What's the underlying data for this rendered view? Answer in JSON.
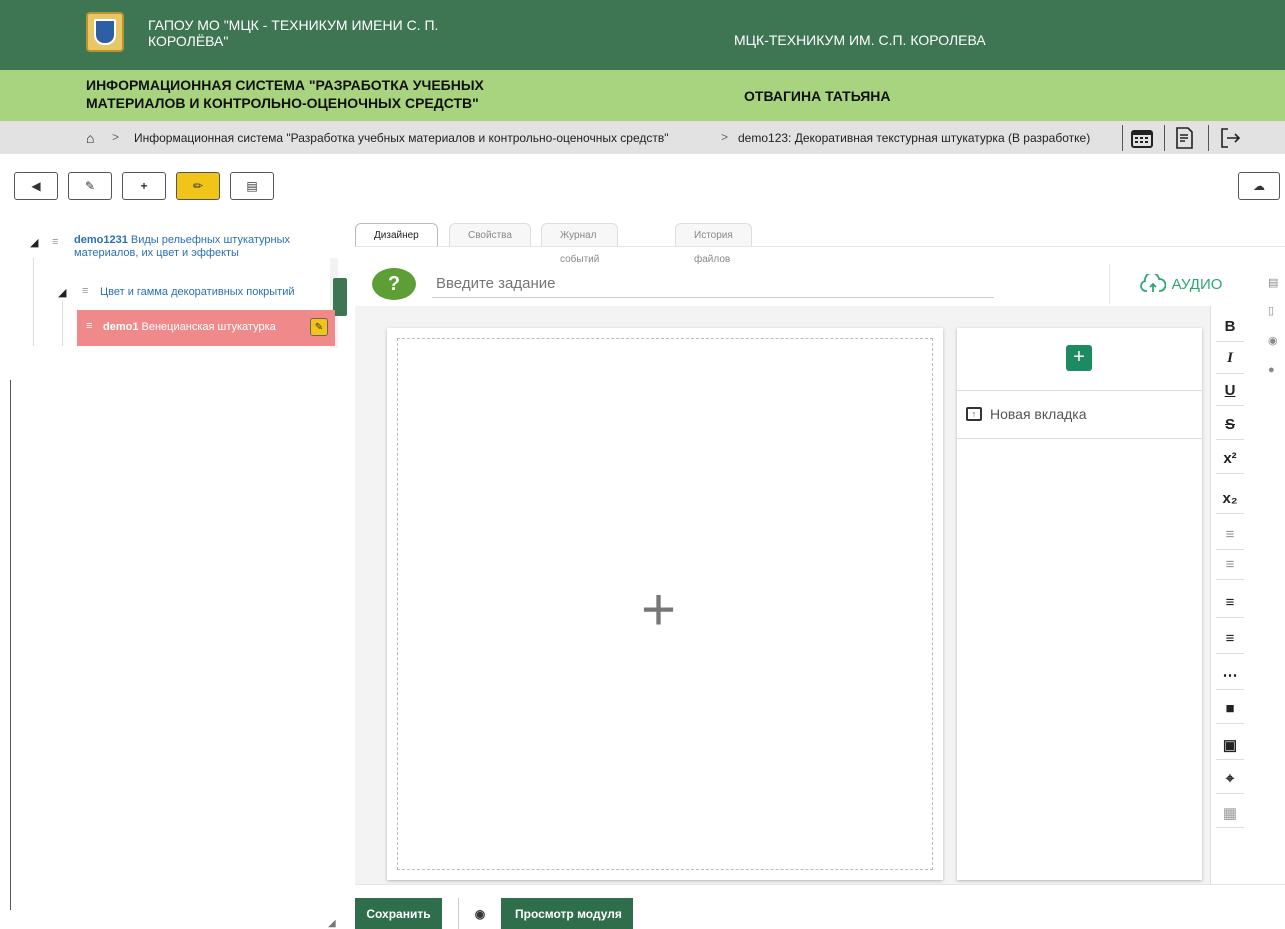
{
  "header": {
    "org_title": "ГАПОУ МО \"МЦК - ТЕХНИКУМ ИМЕНИ С. П. КОРОЛЁВА\"",
    "org_short": "МЦК-ТЕХНИКУМ ИМ. С.П. КОРОЛЕВА",
    "system_title": "ИНФОРМАЦИОННАЯ СИСТЕМА \"РАЗРАБОТКА УЧЕБНЫХ МАТЕРИАЛОВ И КОНТРОЛЬНО-ОЦЕНОЧНЫХ СРЕДСТВ\"",
    "user_name": "ОТВАГИНА ТАТЬЯНА"
  },
  "breadcrumb": {
    "home_icon": "home-icon",
    "items": [
      "Информационная система \"Разработка учебных материалов и контрольно-оценочных средств\"",
      "demo123: Декоративная текстурная штукатурка (В разработке)"
    ],
    "tools": [
      "calendar-icon",
      "document-icon",
      "logout-icon"
    ]
  },
  "toolbar": {
    "buttons": [
      "back-icon",
      "edit-icon",
      "plus-icon",
      "pencil-icon",
      "book-icon"
    ],
    "active": "pencil-icon",
    "cloud": "cloud-upload-icon"
  },
  "tree": {
    "root": {
      "code": "demo1231",
      "label": "Виды рельефных штукатурных материалов, их цвет и эффекты"
    },
    "child": {
      "label": "Цвет и гамма декоративных покрытий"
    },
    "selected": {
      "code": "demo1",
      "label": "Венецианская штукатурка"
    }
  },
  "tabs": [
    "Дизайнер",
    "Свойства",
    "Журнал событий",
    "История файлов"
  ],
  "task": {
    "placeholder": "Введите задание",
    "audio_label": "АУДИО"
  },
  "canvas": {
    "new_tab_label": "Новая вкладка"
  },
  "format_toolbar": [
    "B",
    "I",
    "U",
    "S",
    "x²",
    "x₂",
    "align-left-icon",
    "align-center-icon",
    "bullet-list-icon",
    "numbered-list-icon",
    "ellipsis-icon",
    "comment-icon",
    "image-icon",
    "crop-icon",
    "table-icon"
  ],
  "side_icons": [
    "monitor-icon",
    "folder-icon",
    "eye-icon",
    "help-icon"
  ],
  "footer": {
    "save_label": "Сохранить",
    "preview_label": "Просмотр модуля"
  },
  "colors": {
    "header_green": "#3e7552",
    "light_green": "#a9d47f",
    "accent_yellow": "#f0c419",
    "selected_row": "#f08a8a",
    "action_green": "#1e8a62"
  }
}
